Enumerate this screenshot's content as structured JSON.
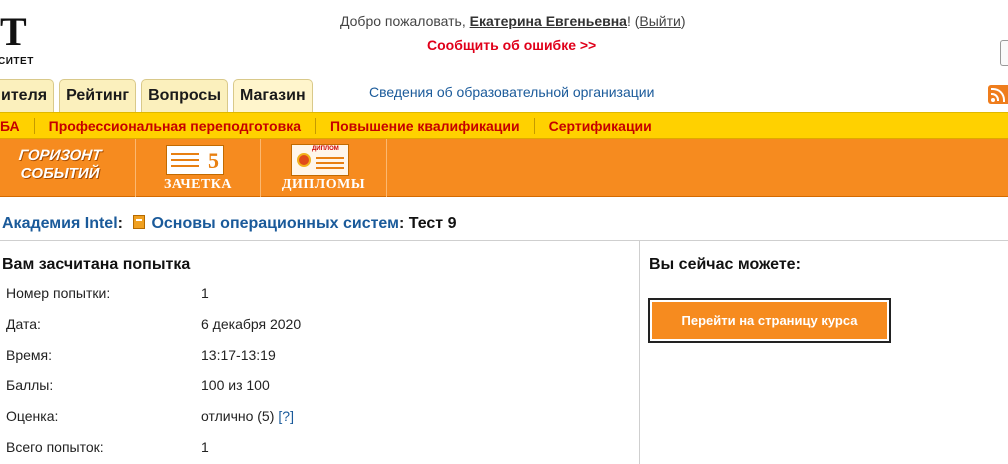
{
  "logo": {
    "letter": "T",
    "caption": "СИТЕТ"
  },
  "header": {
    "welcome_prefix": "Добро пожаловать, ",
    "user_name": "Екатерина Евгеньевна",
    "welcome_bang": "! (",
    "logout": "Выйти",
    "welcome_close": ")",
    "report_error": "Сообщить об ошибке >>"
  },
  "tabs": [
    {
      "label": "ителя"
    },
    {
      "label": "Рейтинг"
    },
    {
      "label": "Вопросы"
    },
    {
      "label": "Магазин"
    }
  ],
  "org_link": "Сведения об образовательной организации",
  "yellow_menu": [
    {
      "label": "БА"
    },
    {
      "label": "Профессиональная переподготовка"
    },
    {
      "label": "Повышение квалификации"
    },
    {
      "label": "Сертификации"
    }
  ],
  "orange_menu": {
    "horizon_line1": "ГОРИЗОНТ",
    "horizon_line2": "СОБЫТИЙ",
    "zachetka_digit": "5",
    "zachetka": "ЗАЧЕТКА",
    "diploma_badge": "ДИПЛОМ",
    "diplomas": "ДИПЛОМЫ"
  },
  "breadcrumb": {
    "academy": "Академия Intel",
    "sep1": ": ",
    "course": "Основы операционных систем",
    "sep2": ": ",
    "current": "Тест 9"
  },
  "attempt": {
    "title": "Вам засчитана попытка",
    "rows": [
      {
        "label": "Номер попытки:",
        "value": "1"
      },
      {
        "label": "Дата:",
        "value": "6 декабря 2020"
      },
      {
        "label": "Время:",
        "value": "13:17-13:19"
      },
      {
        "label": "Баллы:",
        "value": "100 из 100"
      },
      {
        "label": "Оценка:",
        "value": "отлично (5)",
        "help": "[?]"
      },
      {
        "label": "Всего попыток:",
        "value": "1"
      }
    ]
  },
  "actions": {
    "title": "Вы сейчас можете:",
    "go_course": "Перейти на страницу курса"
  },
  "colors": {
    "orange": "#f68b1f",
    "yellow": "#ffd100",
    "link_blue": "#1a5a9a",
    "error_red": "#e0001a"
  }
}
